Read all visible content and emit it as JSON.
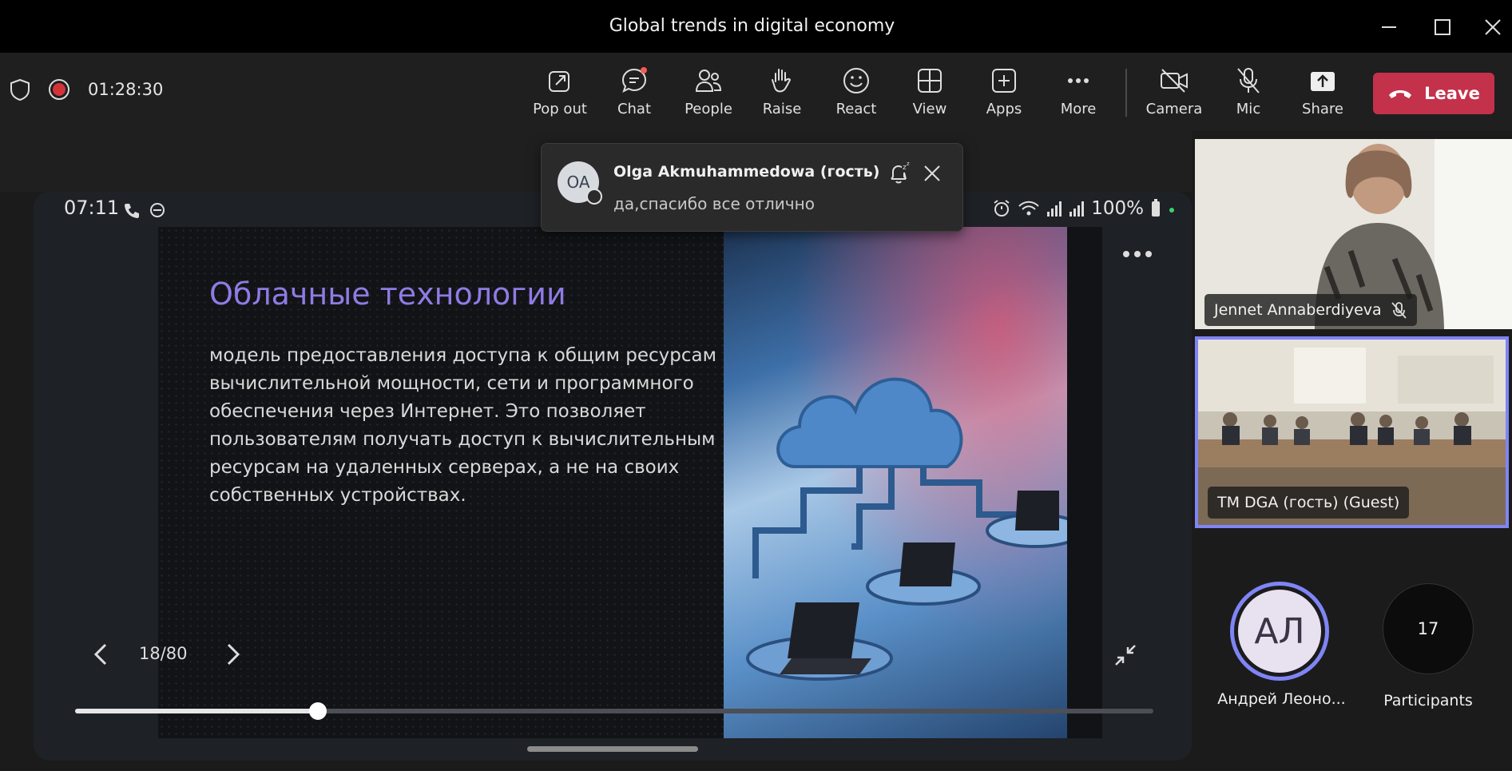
{
  "window": {
    "title": "Global trends in digital economy"
  },
  "meeting": {
    "elapsed": "01:28:30"
  },
  "toolbar": {
    "popout": "Pop out",
    "chat": "Chat",
    "people": "People",
    "raise": "Raise",
    "react": "React",
    "view": "View",
    "apps": "Apps",
    "more": "More",
    "camera": "Camera",
    "mic": "Mic",
    "share": "Share",
    "leave": "Leave"
  },
  "notification": {
    "initials": "OA",
    "sender": "Olga Akmuhammedowa (гость)",
    "message": "да,спасибо все отлично"
  },
  "phone": {
    "clock": "07:11",
    "battery": "100%"
  },
  "slide": {
    "title": "Облачные технологии",
    "body": "модель предоставления доступа к общим ресурсам вычислительной мощности, сети и программного обеспечения через Интернет. Это позволяет пользователям получать доступ к вычислительным ресурсам на удаленных серверах, а не на своих собственных устройствах.",
    "page": "18/80",
    "progress_fraction": 0.225
  },
  "participants": {
    "tile1_name": "Jennet Annaberdiyeva",
    "tile2_name": "TM DGA (гость) (Guest)",
    "avatar_initials": "АЛ",
    "avatar_name": "Андрей Леоно...",
    "count": "17",
    "count_label": "Participants"
  },
  "colors": {
    "leave": "#c4314b",
    "accent": "#7f85f5",
    "slide_title": "#8f7be4"
  }
}
